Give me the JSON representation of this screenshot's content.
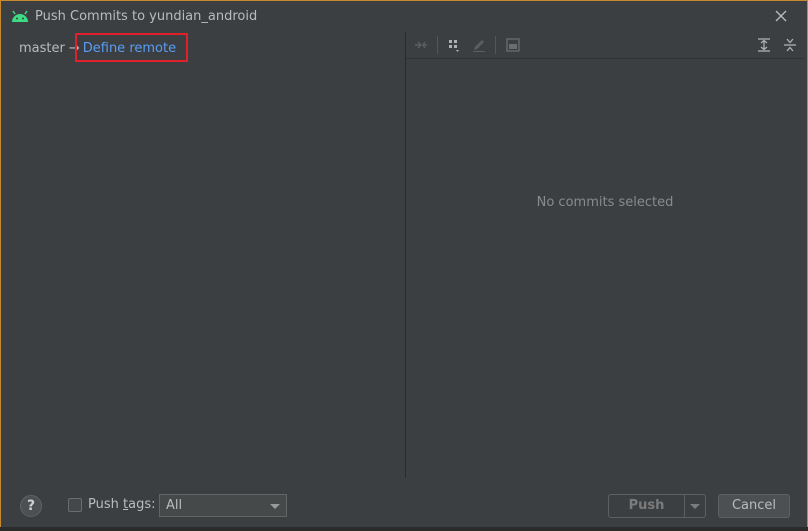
{
  "window": {
    "title": "Push Commits to yundian_android",
    "app_icon": "android-icon",
    "close_icon": "close-icon"
  },
  "left_pane": {
    "branch": "master",
    "arrow": "→",
    "remote_link": "Define remote"
  },
  "right_pane": {
    "toolbar": [
      {
        "name": "diff-arrows-icon",
        "enabled": false
      },
      {
        "name": "group-by-icon",
        "enabled": true
      },
      {
        "name": "edit-pencil-icon",
        "enabled": false
      },
      {
        "name": "preview-icon",
        "enabled": false
      },
      {
        "name": "expand-all-icon",
        "enabled": true
      },
      {
        "name": "collapse-all-icon",
        "enabled": true
      }
    ],
    "empty_text": "No commits selected"
  },
  "footer": {
    "help_label": "?",
    "push_tags_label_pre": "Push ",
    "push_tags_label_mnemonic": "t",
    "push_tags_label_post": "ags:",
    "push_tags_checked": false,
    "tags_select_value": "All",
    "push_label": "Push",
    "cancel_label": "Cancel"
  },
  "colors": {
    "background": "#3c3f41",
    "link": "#589df6",
    "highlight": "#e0202a",
    "dialog_border": "#c9892f",
    "android_green": "#3ddc84"
  }
}
